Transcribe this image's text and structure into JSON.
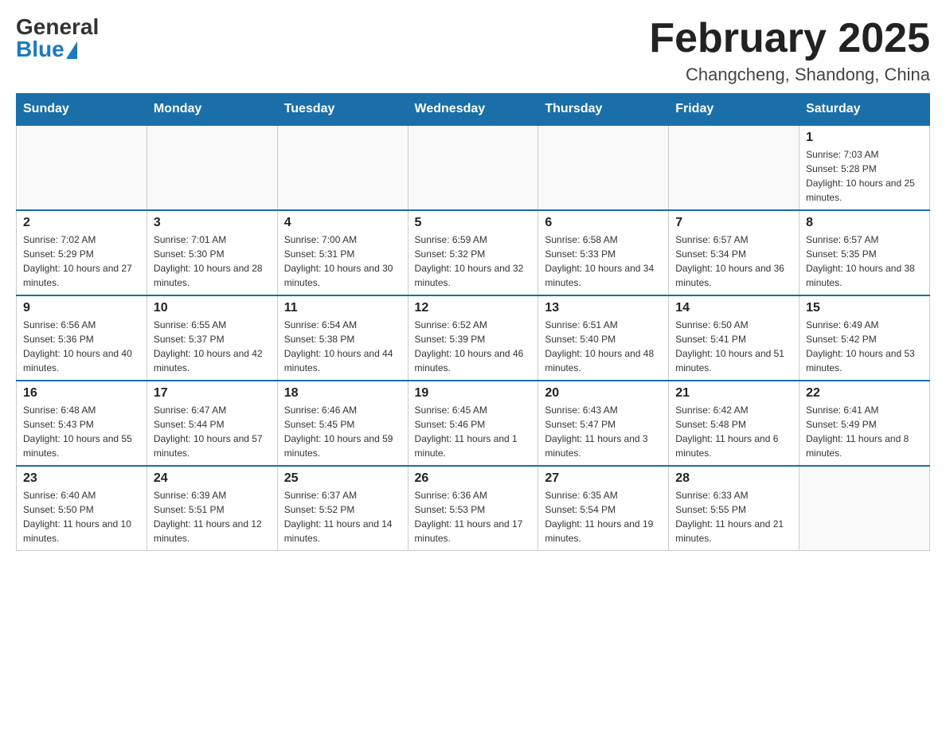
{
  "header": {
    "logo": {
      "general": "General",
      "blue": "Blue"
    },
    "title": "February 2025",
    "location": "Changcheng, Shandong, China"
  },
  "days_of_week": [
    "Sunday",
    "Monday",
    "Tuesday",
    "Wednesday",
    "Thursday",
    "Friday",
    "Saturday"
  ],
  "weeks": [
    [
      {
        "day": "",
        "info": ""
      },
      {
        "day": "",
        "info": ""
      },
      {
        "day": "",
        "info": ""
      },
      {
        "day": "",
        "info": ""
      },
      {
        "day": "",
        "info": ""
      },
      {
        "day": "",
        "info": ""
      },
      {
        "day": "1",
        "info": "Sunrise: 7:03 AM\nSunset: 5:28 PM\nDaylight: 10 hours and 25 minutes."
      }
    ],
    [
      {
        "day": "2",
        "info": "Sunrise: 7:02 AM\nSunset: 5:29 PM\nDaylight: 10 hours and 27 minutes."
      },
      {
        "day": "3",
        "info": "Sunrise: 7:01 AM\nSunset: 5:30 PM\nDaylight: 10 hours and 28 minutes."
      },
      {
        "day": "4",
        "info": "Sunrise: 7:00 AM\nSunset: 5:31 PM\nDaylight: 10 hours and 30 minutes."
      },
      {
        "day": "5",
        "info": "Sunrise: 6:59 AM\nSunset: 5:32 PM\nDaylight: 10 hours and 32 minutes."
      },
      {
        "day": "6",
        "info": "Sunrise: 6:58 AM\nSunset: 5:33 PM\nDaylight: 10 hours and 34 minutes."
      },
      {
        "day": "7",
        "info": "Sunrise: 6:57 AM\nSunset: 5:34 PM\nDaylight: 10 hours and 36 minutes."
      },
      {
        "day": "8",
        "info": "Sunrise: 6:57 AM\nSunset: 5:35 PM\nDaylight: 10 hours and 38 minutes."
      }
    ],
    [
      {
        "day": "9",
        "info": "Sunrise: 6:56 AM\nSunset: 5:36 PM\nDaylight: 10 hours and 40 minutes."
      },
      {
        "day": "10",
        "info": "Sunrise: 6:55 AM\nSunset: 5:37 PM\nDaylight: 10 hours and 42 minutes."
      },
      {
        "day": "11",
        "info": "Sunrise: 6:54 AM\nSunset: 5:38 PM\nDaylight: 10 hours and 44 minutes."
      },
      {
        "day": "12",
        "info": "Sunrise: 6:52 AM\nSunset: 5:39 PM\nDaylight: 10 hours and 46 minutes."
      },
      {
        "day": "13",
        "info": "Sunrise: 6:51 AM\nSunset: 5:40 PM\nDaylight: 10 hours and 48 minutes."
      },
      {
        "day": "14",
        "info": "Sunrise: 6:50 AM\nSunset: 5:41 PM\nDaylight: 10 hours and 51 minutes."
      },
      {
        "day": "15",
        "info": "Sunrise: 6:49 AM\nSunset: 5:42 PM\nDaylight: 10 hours and 53 minutes."
      }
    ],
    [
      {
        "day": "16",
        "info": "Sunrise: 6:48 AM\nSunset: 5:43 PM\nDaylight: 10 hours and 55 minutes."
      },
      {
        "day": "17",
        "info": "Sunrise: 6:47 AM\nSunset: 5:44 PM\nDaylight: 10 hours and 57 minutes."
      },
      {
        "day": "18",
        "info": "Sunrise: 6:46 AM\nSunset: 5:45 PM\nDaylight: 10 hours and 59 minutes."
      },
      {
        "day": "19",
        "info": "Sunrise: 6:45 AM\nSunset: 5:46 PM\nDaylight: 11 hours and 1 minute."
      },
      {
        "day": "20",
        "info": "Sunrise: 6:43 AM\nSunset: 5:47 PM\nDaylight: 11 hours and 3 minutes."
      },
      {
        "day": "21",
        "info": "Sunrise: 6:42 AM\nSunset: 5:48 PM\nDaylight: 11 hours and 6 minutes."
      },
      {
        "day": "22",
        "info": "Sunrise: 6:41 AM\nSunset: 5:49 PM\nDaylight: 11 hours and 8 minutes."
      }
    ],
    [
      {
        "day": "23",
        "info": "Sunrise: 6:40 AM\nSunset: 5:50 PM\nDaylight: 11 hours and 10 minutes."
      },
      {
        "day": "24",
        "info": "Sunrise: 6:39 AM\nSunset: 5:51 PM\nDaylight: 11 hours and 12 minutes."
      },
      {
        "day": "25",
        "info": "Sunrise: 6:37 AM\nSunset: 5:52 PM\nDaylight: 11 hours and 14 minutes."
      },
      {
        "day": "26",
        "info": "Sunrise: 6:36 AM\nSunset: 5:53 PM\nDaylight: 11 hours and 17 minutes."
      },
      {
        "day": "27",
        "info": "Sunrise: 6:35 AM\nSunset: 5:54 PM\nDaylight: 11 hours and 19 minutes."
      },
      {
        "day": "28",
        "info": "Sunrise: 6:33 AM\nSunset: 5:55 PM\nDaylight: 11 hours and 21 minutes."
      },
      {
        "day": "",
        "info": ""
      }
    ]
  ]
}
